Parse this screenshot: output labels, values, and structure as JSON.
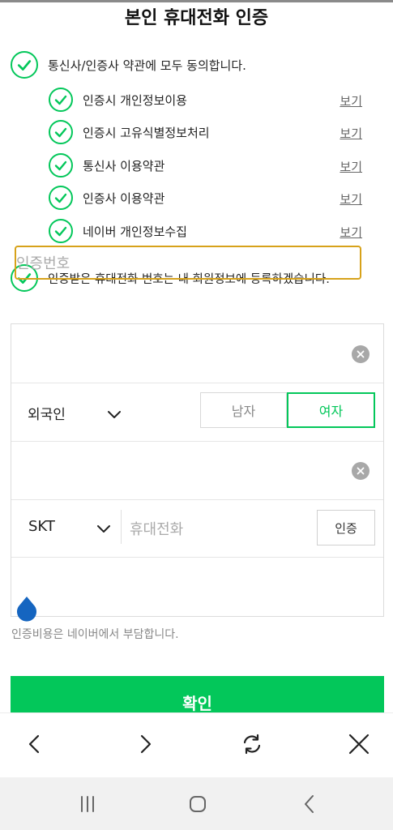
{
  "title": "본인 휴대전화 인증",
  "agreements": {
    "all_label": "통신사/인증사 약관에 모두 동의합니다.",
    "items": [
      {
        "label": "인증시 개인정보이용",
        "link": "보기"
      },
      {
        "label": "인증시 고유식별정보처리",
        "link": "보기"
      },
      {
        "label": "통신사 이용약관",
        "link": "보기"
      },
      {
        "label": "인증사 이용약관",
        "link": "보기"
      },
      {
        "label": "네이버 개인정보수집",
        "link": "보기"
      }
    ],
    "register_label": "인증받은 휴대전화 번호는 내 회원정보에 등록하겠습니다."
  },
  "form": {
    "nationality": "외국인",
    "gender_male": "남자",
    "gender_female": "여자",
    "selected_gender": "여자",
    "carrier": "SKT",
    "phone_placeholder": "휴대전화",
    "auth_button": "인증",
    "code_placeholder": "인증번호"
  },
  "note": "인증비용은 네이버에서 부담합니다.",
  "confirm_label": "확인",
  "colors": {
    "accent": "#03c75a",
    "focus_border": "#d7a21a",
    "handle": "#1565c0"
  },
  "browser_toolbar": [
    "back-icon",
    "forward-icon",
    "refresh-icon",
    "close-icon"
  ],
  "system_nav": [
    "recent-apps-icon",
    "home-icon",
    "back-icon"
  ]
}
